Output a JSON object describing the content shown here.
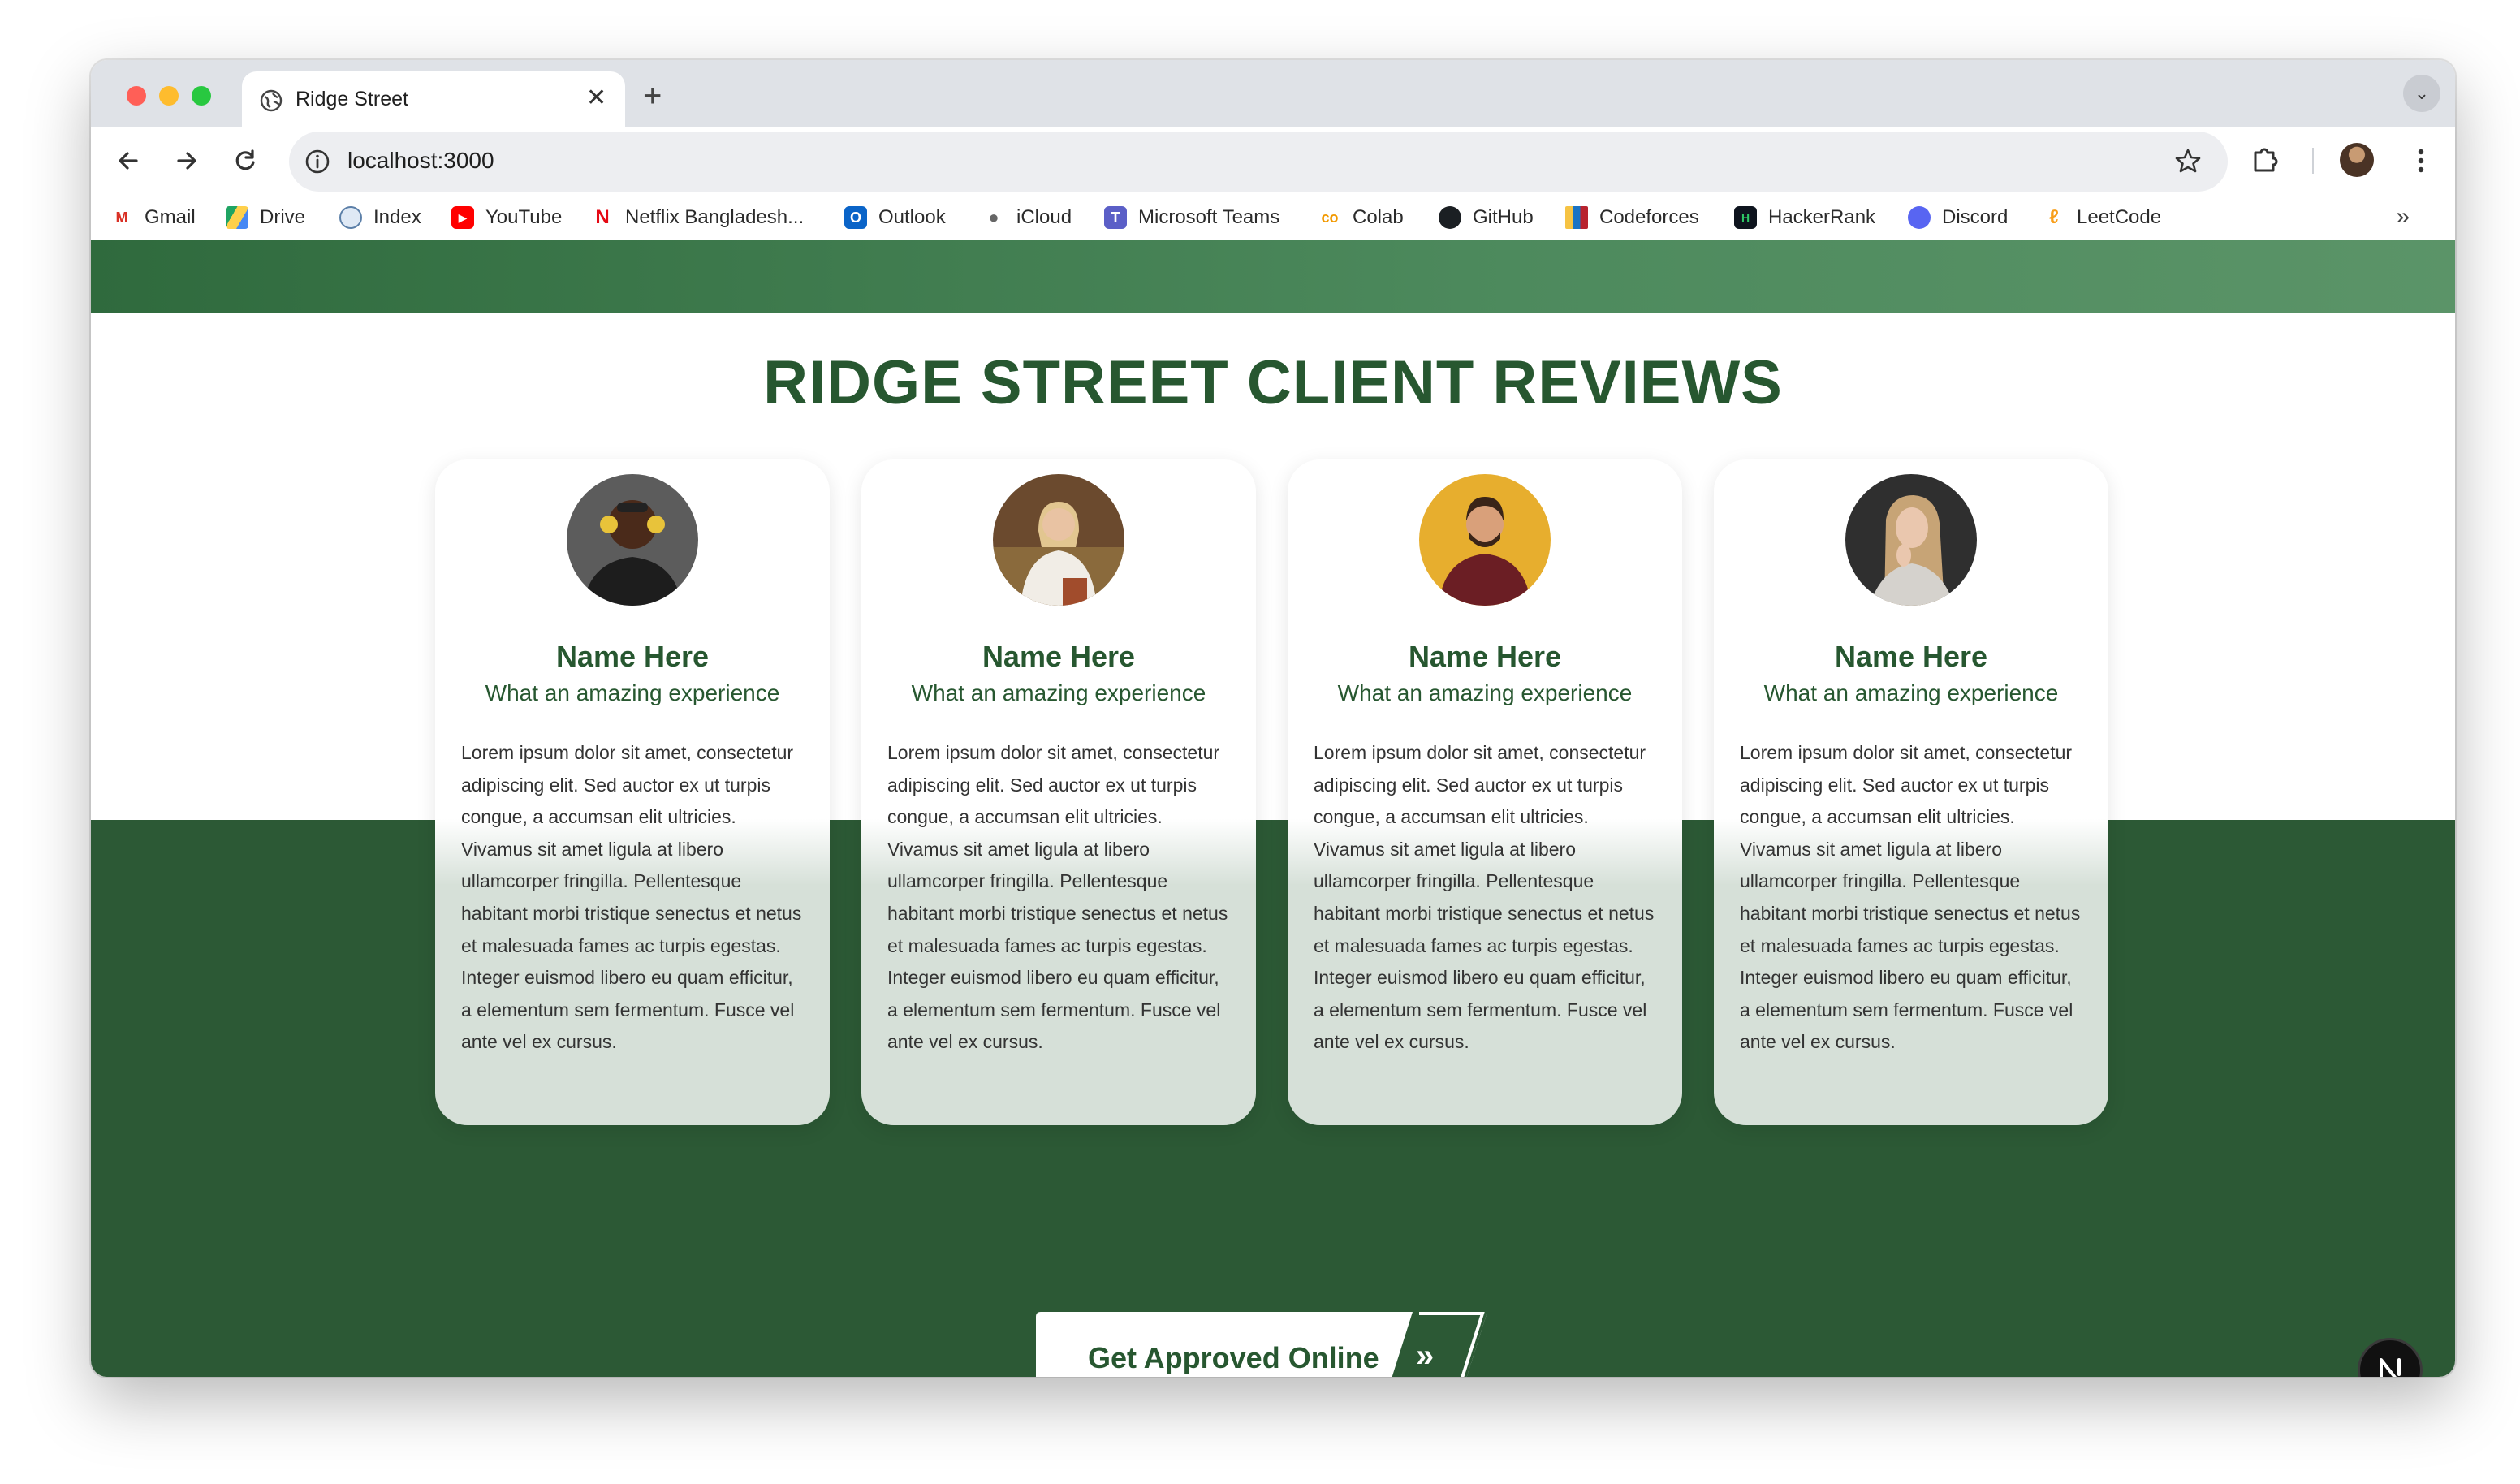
{
  "browser": {
    "tab_title": "Ridge Street",
    "url": "localhost:3000",
    "bookmarks": [
      {
        "label": "Gmail",
        "icon": "gmail-icon"
      },
      {
        "label": "Drive",
        "icon": "drive-icon"
      },
      {
        "label": "Index",
        "icon": "index-icon"
      },
      {
        "label": "YouTube",
        "icon": "youtube-icon"
      },
      {
        "label": "Netflix Bangladesh...",
        "icon": "netflix-icon"
      },
      {
        "label": "Outlook",
        "icon": "outlook-icon"
      },
      {
        "label": "iCloud",
        "icon": "icloud-icon"
      },
      {
        "label": "Microsoft Teams",
        "icon": "teams-icon"
      },
      {
        "label": "Colab",
        "icon": "colab-icon"
      },
      {
        "label": "GitHub",
        "icon": "github-icon"
      },
      {
        "label": "Codeforces",
        "icon": "codeforces-icon"
      },
      {
        "label": "HackerRank",
        "icon": "hackerrank-icon"
      },
      {
        "label": "Discord",
        "icon": "discord-icon"
      },
      {
        "label": "LeetCode",
        "icon": "leetcode-icon"
      }
    ]
  },
  "page": {
    "section_title": "RIDGE STREET CLIENT REVIEWS",
    "reviews": [
      {
        "name": "Name Here",
        "tagline": "What an amazing experience",
        "body": "Lorem ipsum dolor sit amet, consectetur adipiscing elit. Sed auctor ex ut turpis congue, a accumsan elit ultricies. Vivamus sit amet ligula at libero ullamcorper fringilla. Pellentesque habitant morbi tristique senectus et netus et malesuada fames ac turpis egestas. Integer euismod libero eu quam efficitur, a elementum sem fermentum. Fusce vel ante vel ex cursus."
      },
      {
        "name": "Name Here",
        "tagline": "What an amazing experience",
        "body": "Lorem ipsum dolor sit amet, consectetur adipiscing elit. Sed auctor ex ut turpis congue, a accumsan elit ultricies. Vivamus sit amet ligula at libero ullamcorper fringilla. Pellentesque habitant morbi tristique senectus et netus et malesuada fames ac turpis egestas. Integer euismod libero eu quam efficitur, a elementum sem fermentum. Fusce vel ante vel ex cursus."
      },
      {
        "name": "Name Here",
        "tagline": "What an amazing experience",
        "body": "Lorem ipsum dolor sit amet, consectetur adipiscing elit. Sed auctor ex ut turpis congue, a accumsan elit ultricies. Vivamus sit amet ligula at libero ullamcorper fringilla. Pellentesque habitant morbi tristique senectus et netus et malesuada fames ac turpis egestas. Integer euismod libero eu quam efficitur, a elementum sem fermentum. Fusce vel ante vel ex cursus."
      },
      {
        "name": "Name Here",
        "tagline": "What an amazing experience",
        "body": "Lorem ipsum dolor sit amet, consectetur adipiscing elit. Sed auctor ex ut turpis congue, a accumsan elit ultricies. Vivamus sit amet ligula at libero ullamcorper fringilla. Pellentesque habitant morbi tristique senectus et netus et malesuada fames ac turpis egestas. Integer euismod libero eu quam efficitur, a elementum sem fermentum. Fusce vel ante vel ex cursus."
      }
    ],
    "cta_label": "Get Approved Online",
    "cta_arrows": "»",
    "next_badge": "N"
  },
  "colors": {
    "brand_green": "#275730",
    "band_green": "#2c5935",
    "card_tint": "#d6e0d8"
  }
}
